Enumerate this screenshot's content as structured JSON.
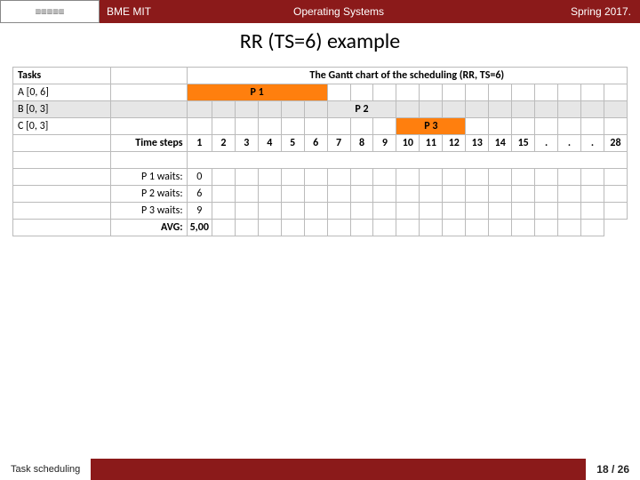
{
  "header": {
    "left": "BME MIT",
    "center": "Operating Systems",
    "right": "Spring 2017."
  },
  "title": "RR (TS=6) example",
  "chart_data": {
    "type": "table",
    "title": "The Gantt chart of the scheduling (RR, TS=6)",
    "tasks_header": "Tasks",
    "time_steps_label": "Time steps",
    "steps": [
      "1",
      "2",
      "3",
      "4",
      "5",
      "6",
      "7",
      "8",
      "9",
      "10",
      "11",
      "12",
      "13",
      "14",
      "15",
      ".",
      ".",
      ".",
      "28"
    ],
    "rows": [
      {
        "task": "A [0, 6]",
        "bar_label": "P 1",
        "bar_start": 1,
        "bar_end": 6,
        "shade": false
      },
      {
        "task": "B [0, 3]",
        "bar_label": "P 2",
        "bar_start": 7,
        "bar_end": 9,
        "shade": true
      },
      {
        "task": "C [0, 3]",
        "bar_label": "P 3",
        "bar_start": 10,
        "bar_end": 12,
        "shade": false
      }
    ],
    "waits": [
      {
        "label": "P 1 waits:",
        "value": "0"
      },
      {
        "label": "P 2 waits:",
        "value": "6"
      },
      {
        "label": "P 3 waits:",
        "value": "9"
      }
    ],
    "avg_label": "AVG:",
    "avg_value": "5,00"
  },
  "footer": {
    "topic": "Task scheduling",
    "page": "18 / 26"
  }
}
